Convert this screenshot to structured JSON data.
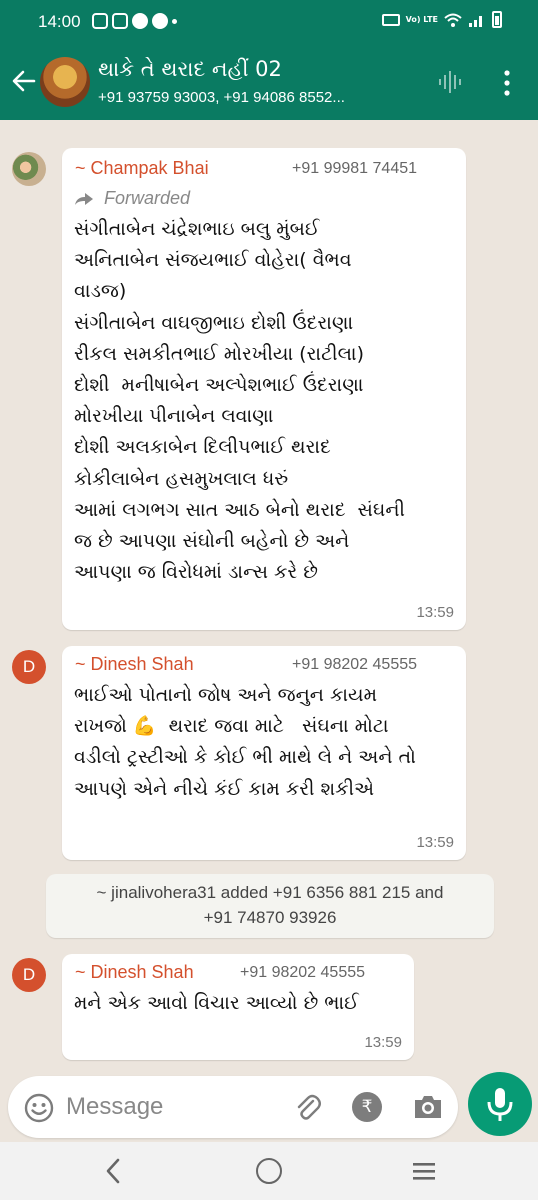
{
  "status_bar": {
    "time": "14:00",
    "network_label": "Vo) LTE",
    "icons": [
      "instagram-icon",
      "instagram-icon",
      "messenger-icon",
      "messenger-icon",
      "notification-dot",
      "vibrate-icon",
      "wifi-icon",
      "signal-icon",
      "battery-icon"
    ]
  },
  "header": {
    "title": "થાકે તે થરાદ નહીં 02",
    "subtitle": "+91 93759 93003, +91 94086 8552...",
    "colors": {
      "bar": "#0a7b62"
    }
  },
  "messages": [
    {
      "sender": "~ Champak Bhai",
      "phone": "+91 99981 74451",
      "forwarded_label": "Forwarded",
      "text_lines": [
        "સંગીતાબેન ચંદ્રેશભાઇ બલુ મુંબઈ",
        "અનિતાબેન સંજયભાઈ વોહેરા( વૈભવ",
        "વાડજ)",
        "સંગીતાબેન વાઘજીભાઇ દોશી ઉંદરાણા",
        "રીકલ સમકીતભાઈ મોરખીયા (રાટીલા)",
        "દોશી  મનીષાબેન અલ્પેશભાઈ ઉંદરાણા",
        "મોરખીયા પીનાબેન લવાણા",
        "દોશી અલકાબેન દિલીપભાઈ થરાદ",
        "કોકીલાબેન હસમુખલાલ ધરું",
        "આમાં લગભગ સાત આઠ બેનો થરાદ  સંઘની",
        "જ છે આપણા સંઘોની બહેનો છે અને",
        "આપણા જ વિરોધમાં ડાન્સ કરે છે"
      ],
      "time": "13:59"
    },
    {
      "avatar_letter": "D",
      "sender": "~ Dinesh Shah",
      "phone": "+91 98202 45555",
      "text_lines": [
        "ભાઈઓ પોતાનો જોષ અને જનુન કાયમ",
        "રાખજો 💪  થરાદ જવા માટે   સંઘના મોટા",
        "વડીલો ટ્રસ્ટીઓ કે કોઈ ભી માથે લે ને અને તો",
        "આપણે એને નીચે કંઈ કામ કરી શકીએ"
      ],
      "time": "13:59"
    },
    {
      "system_lines": [
        "~ jinalivohera31 added +91 6356 881 215 and",
        "+91 74870 93926"
      ]
    },
    {
      "avatar_letter": "D",
      "sender": "~ Dinesh Shah",
      "phone": "+91 98202 45555",
      "text_lines": [
        "મને એક આવો વિચાર આવ્યો છે ભાઈ"
      ],
      "time": "13:59"
    }
  ],
  "input_bar": {
    "placeholder": "Message",
    "icons": [
      "emoji-icon",
      "attach-icon",
      "rupee-icon",
      "camera-icon",
      "mic-icon"
    ],
    "rupee_symbol": "₹"
  },
  "colors": {
    "accent": "#079b75",
    "sender_name": "#d4502d",
    "chat_bg": "#ece5dd"
  }
}
